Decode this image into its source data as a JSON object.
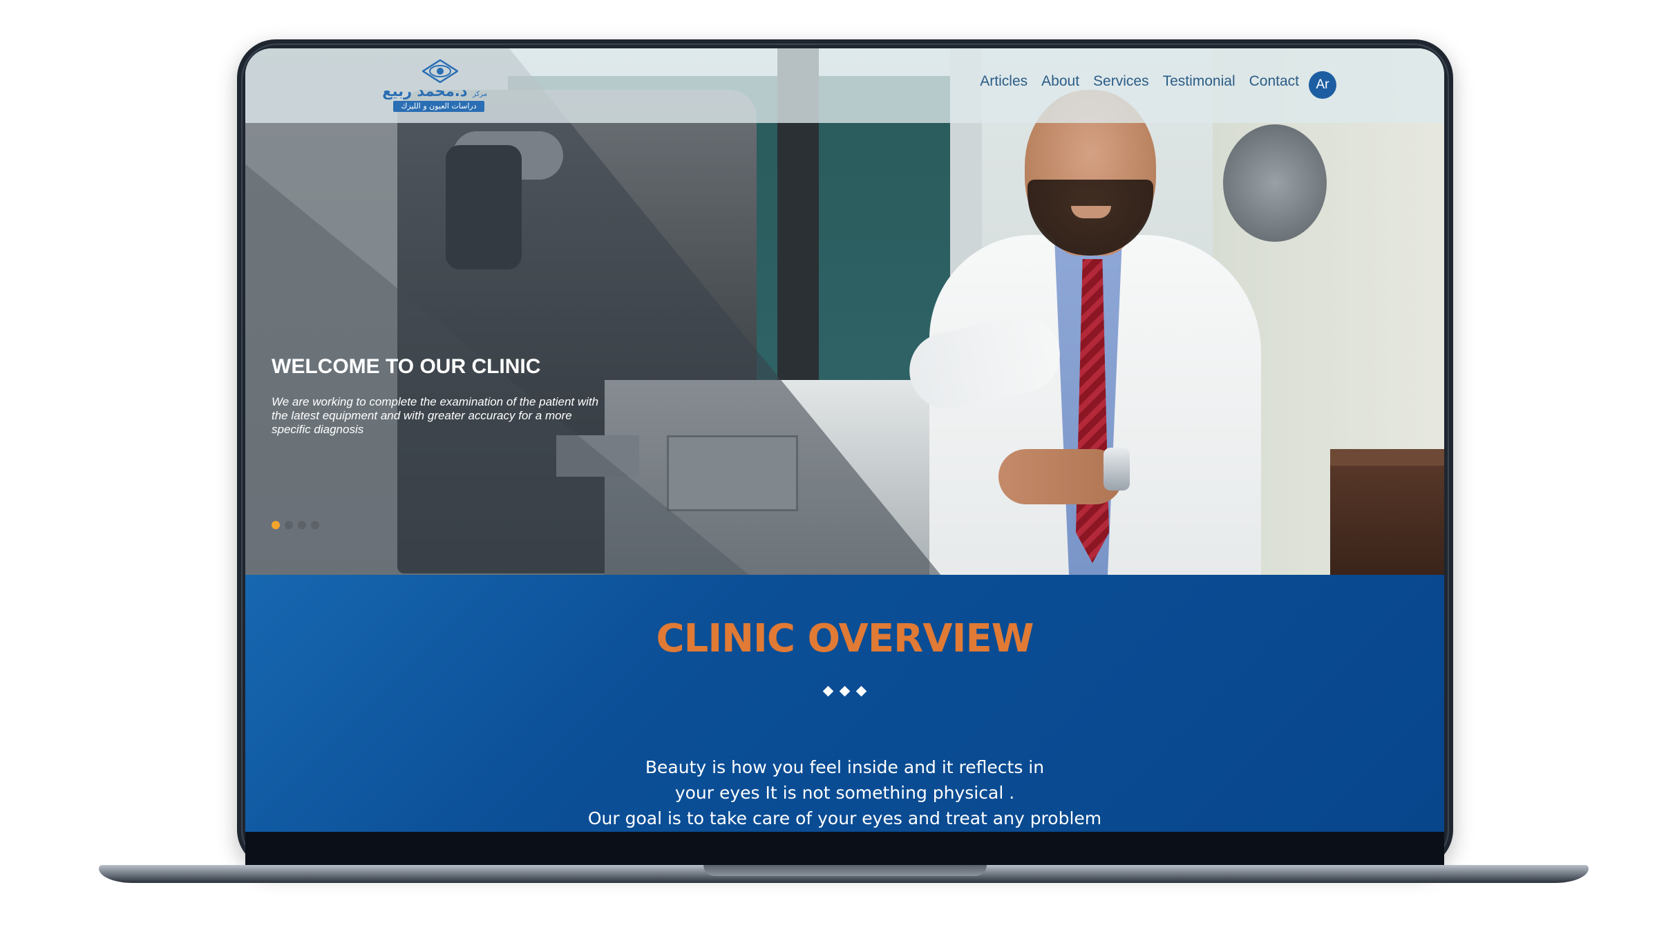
{
  "logo": {
    "title": "د.محمد ربيع",
    "prefix": "مركز",
    "subtitle": "دراسات العيون و الليزك",
    "icon": "eye-logo-icon"
  },
  "nav": {
    "items": [
      "Articles",
      "About",
      "Services",
      "Testimonial",
      "Contact"
    ],
    "language_button": "Ar"
  },
  "hero": {
    "title": "WELCOME TO OUR CLINIC",
    "description": "We are working to complete the examination of the patient with the latest equipment and with greater accuracy for a more specific diagnosis",
    "slide_count": 4,
    "active_slide": 1
  },
  "overview": {
    "title": "CLINIC OVERVIEW",
    "line1": "Beauty is how you feel inside and it reflects in",
    "line2": "your eyes It is not something physical .",
    "line3": "Our goal is to take care of your eyes and treat any problem"
  },
  "colors": {
    "accent_orange": "#e07a35",
    "brand_blue": "#0b4f97",
    "nav_text": "#2b5c86",
    "active_dot": "#f3a52b"
  }
}
